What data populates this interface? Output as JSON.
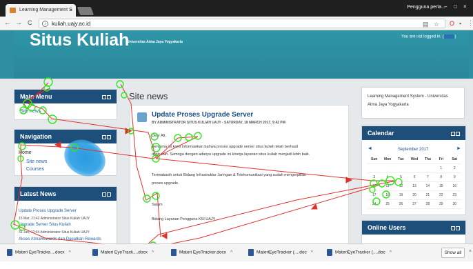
{
  "browser": {
    "tab_title": "Learning Management S",
    "tab_close": "×",
    "profile_name": "Pengguna perta...",
    "window_controls": [
      "–",
      "□",
      "×"
    ],
    "url": "kuliah.uajy.ac.id",
    "back": "←",
    "forward": "→",
    "reload": "C"
  },
  "header": {
    "site_title": "Situs Kuliah",
    "site_subtitle": "Universitas Atma Jaya Yogyakarta",
    "login_text": "You are not logged in. ("
  },
  "main_menu": {
    "title": "Main Menu",
    "item": "Site news"
  },
  "navigation": {
    "title": "Navigation",
    "items": [
      "Home",
      "Site news",
      "Courses"
    ]
  },
  "latest_news": {
    "title": "Latest News",
    "items": [
      {
        "date": "",
        "title": "Update Proses Upgrade Server"
      },
      {
        "date": "15 Mar, 21:42  Administrator Situs Kuliah UAJY",
        "title": "Upgrade Server Situs Kuliah"
      },
      {
        "date": "31 Jan, 12:44  Administrator Situs Kuliah UAJY",
        "title": "Akses AtmaRewards dan Dapatkan Rewards"
      }
    ]
  },
  "site_news": {
    "heading": "Site news",
    "post": {
      "title": "Update Proses Upgrade Server",
      "byline": "BY ADMINISTRATOR SITUS KULIAH UAJY - SATURDAY, 18 MARCH 2017, 9:42 PM",
      "greeting": "Dear All,",
      "body_lines": [
        "Bersama ini kami informasikan bahwa proses upgrade server situs kuliah telah berhasil",
        "dilakukan. Semoga dengan adanya upgrade ini kinerja layanan situs kuliah menjadi lebih baik.",
        "Terimakasih untuk Bidang Infrastruktur Jaringan & Telekomunikasi yang sudah mengerjakan",
        "proses upgrade."
      ],
      "salutation": "Salam",
      "signature": "Bidang Layanan Pengguna KSI UAJY"
    }
  },
  "lms_block": {
    "line1": "Learning Management System - Universitas",
    "line2": "Atma Jaya Yogyakarta"
  },
  "calendar": {
    "title": "Calendar",
    "month": "September 2017",
    "prev": "◄",
    "next": "►",
    "weekdays": [
      "Sun",
      "Mon",
      "Tue",
      "Wed",
      "Thu",
      "Fri",
      "Sat"
    ],
    "weeks": [
      [
        "",
        "",
        "",
        "",
        "",
        "1",
        "2"
      ],
      [
        "3",
        "4",
        "5",
        "6",
        "7",
        "8",
        "9"
      ],
      [
        "10",
        "11",
        "12",
        "13",
        "14",
        "15",
        "16"
      ],
      [
        "17",
        "18",
        "19",
        "20",
        "21",
        "22",
        "23"
      ],
      [
        "24",
        "25",
        "26",
        "27",
        "28",
        "29",
        "30"
      ]
    ]
  },
  "online_users": {
    "title": "Online Users"
  },
  "downloads": {
    "items": [
      "Materi EyeTracke....docx",
      "Materi EyeTrack....docx",
      "Materi EyeTracker.docx",
      "MateriEyeTracker (....doc",
      "MateriEyeTracker (....doc"
    ],
    "show_all": "Show all",
    "close": "×"
  },
  "colors": {
    "header_teal": "#2e96a7",
    "block_header_navy": "#1d4f7a",
    "link_blue": "#1f5ea8",
    "gaze_line_red": "#e0312b",
    "fixation_green": "#32e61e",
    "gaze_blob_blue": "#2a9be0"
  }
}
